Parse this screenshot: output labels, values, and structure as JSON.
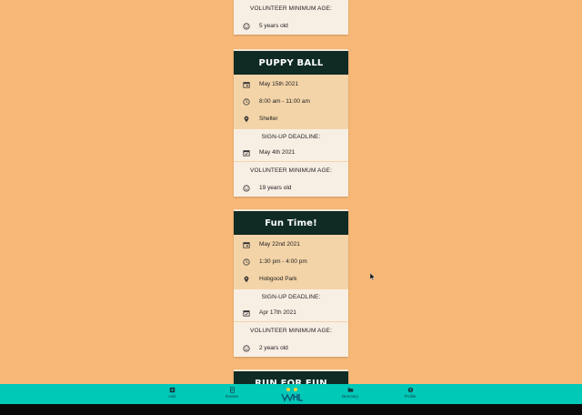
{
  "events": [
    {
      "title": "",
      "date": "",
      "time": "",
      "location": "",
      "signup_label": "",
      "signup_date": "",
      "min_age_label": "VOLUNTEER MINIMUM AGE:",
      "min_age": "5 years old"
    },
    {
      "title": "PUPPY BALL",
      "date": "May 15th 2021",
      "time": "8:00 am - 11:00 am",
      "location": "Shelter",
      "signup_label": "SIGN-UP DEADLINE:",
      "signup_date": "May 4th 2021",
      "min_age_label": "VOLUNTEER MINIMUM AGE:",
      "min_age": "19 years old"
    },
    {
      "title": "Fun Time!",
      "date": "May 22nd 2021",
      "time": "1:30 pm - 4:00 pm",
      "location": "Hobgood Park",
      "signup_label": "SIGN-UP DEADLINE:",
      "signup_date": "Apr 17th 2021",
      "min_age_label": "VOLUNTEER MINIMUM AGE:",
      "min_age": "2 years old"
    },
    {
      "title": "RUN FOR FUN"
    }
  ],
  "nav": {
    "items": [
      {
        "label": "Add",
        "icon": "add-note-icon"
      },
      {
        "label": "Events",
        "icon": "event-list-icon"
      },
      {
        "label": "Directory",
        "icon": "directory-icon"
      },
      {
        "label": "Profile",
        "icon": "profile-icon"
      }
    ],
    "logo": "logo-icon"
  },
  "colors": {
    "background": "#f7b877",
    "card_header": "#0f2b24",
    "detail_bg": "#f3d4a8",
    "section_bg": "#f8efe4",
    "nav_bg": "#00c9b8"
  }
}
